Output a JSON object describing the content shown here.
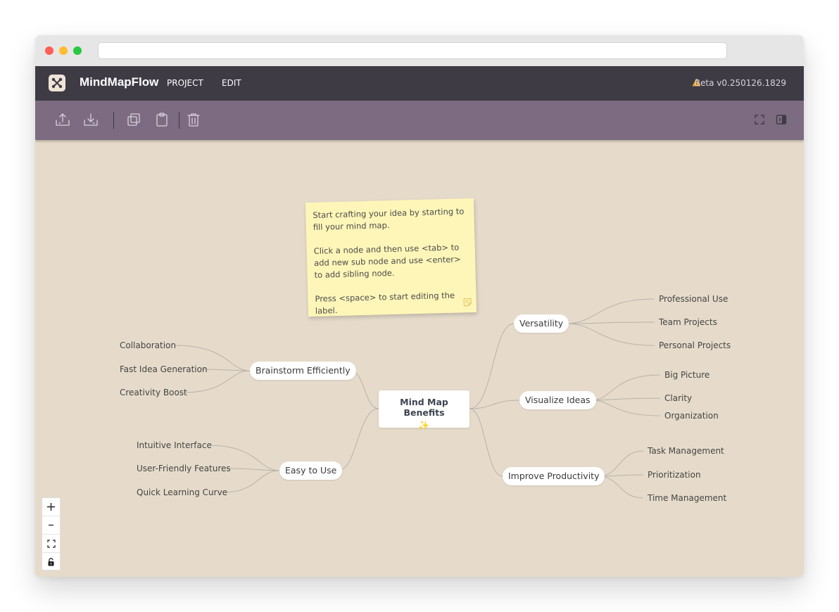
{
  "app": {
    "brand": "MindMapFlow",
    "menu": [
      "PROJECT",
      "EDIT"
    ],
    "version": "Beta v0.250126.1829"
  },
  "toolbar": {
    "left_icons": [
      "upload-icon",
      "download-icon",
      "copy-icon",
      "paste-icon",
      "trash-icon"
    ],
    "right_icons": [
      "fullscreen-icon",
      "sidebar-toggle-icon"
    ]
  },
  "sticky_note": {
    "lines": [
      "Start crafting your idea by starting to fill your mind map.",
      "Click a node and then use <tab> to add new sub node and use <enter> to add sibling node.",
      "Press <space>  to start editing the label."
    ]
  },
  "mindmap": {
    "root": {
      "label": "Mind Map Benefits",
      "emoji": "✨"
    },
    "branches": [
      {
        "label": "Brainstorm Efficiently",
        "children": [
          "Collaboration",
          "Fast Idea Generation",
          "Creativity Boost"
        ]
      },
      {
        "label": "Easy to Use",
        "children": [
          "Intuitive Interface",
          "User-Friendly Features",
          "Quick Learning Curve"
        ]
      },
      {
        "label": "Versatility",
        "children": [
          "Professional Use",
          "Team Projects",
          "Personal Projects"
        ]
      },
      {
        "label": "Visualize Ideas",
        "children": [
          "Big Picture",
          "Clarity",
          "Organization"
        ]
      },
      {
        "label": "Improve Productivity",
        "children": [
          "Task Management",
          "Prioritization",
          "Time Management"
        ]
      }
    ]
  },
  "zoom_controls": [
    "zoom-in-icon",
    "zoom-out-icon",
    "fit-view-icon",
    "lock-icon"
  ],
  "colors": {
    "header_bg": "#3e3b45",
    "toolbar_bg": "#7c6b81",
    "canvas_bg": "#e6dbca",
    "note_bg": "#fef6b8",
    "edge": "#b9b2aa"
  }
}
